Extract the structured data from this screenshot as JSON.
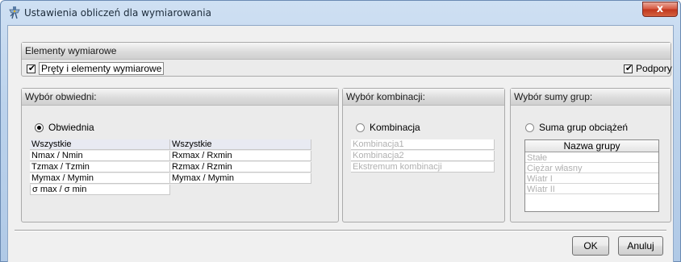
{
  "window": {
    "title": "Ustawienia obliczeń dla wymiarowania",
    "close_symbol": "x"
  },
  "elements_section": {
    "header": "Elementy wymiarowe",
    "bars_checkbox": {
      "label": "Pręty i elementy wymiarowe",
      "checked": true
    },
    "supports_checkbox": {
      "label": "Podpory",
      "checked": true
    }
  },
  "envelope_panel": {
    "header": "Wybór obwiedni:",
    "radio_label": "Obwiednia",
    "radio_selected": true,
    "left_column": [
      "Wszystkie",
      "Nmax / Nmin",
      "Tzmax / Tzmin",
      "Mymax / Mymin",
      "σ max / σ min"
    ],
    "right_column": [
      "Wszystkie",
      "Rxmax / Rxmin",
      "Rzmax / Rzmin",
      "Mymax / Mymin"
    ]
  },
  "combination_panel": {
    "header": "Wybór kombinacji:",
    "radio_label": "Kombinacja",
    "radio_selected": false,
    "items": [
      "Kombinacja1",
      "Kombinacja2",
      "Ekstremum kombinacji"
    ]
  },
  "groups_panel": {
    "header": "Wybór sumy grup:",
    "radio_label": "Suma grup obciążeń",
    "radio_selected": false,
    "column_header": "Nazwa grupy",
    "items": [
      "Stałe",
      "Ciężar własny",
      "Wiatr I",
      "Wiatr II"
    ]
  },
  "buttons": {
    "ok": "OK",
    "cancel": "Anuluj"
  },
  "check_mark": "✔",
  "colors": {
    "title_bar": "#bcd3ec",
    "close_button": "#c0361d",
    "panel_background": "#ebebeb",
    "disabled_text": "#b0b0b0"
  }
}
